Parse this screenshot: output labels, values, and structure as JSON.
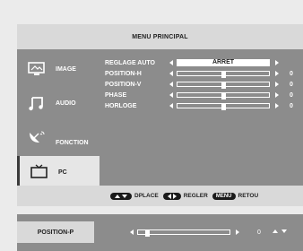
{
  "menu": {
    "title": "MENU PRINCIPAL",
    "sidebar": [
      {
        "label": "IMAGE",
        "icon": "monitor-icon",
        "active": false
      },
      {
        "label": "AUDIO",
        "icon": "music-note-icon",
        "active": false
      },
      {
        "label": "FONCTION",
        "icon": "satellite-dish-icon",
        "active": false
      },
      {
        "label": "PC",
        "icon": "tv-icon",
        "active": true
      }
    ],
    "settings": [
      {
        "label": "REGLAGE AUTO",
        "type": "select",
        "value": "ARRET"
      },
      {
        "label": "POSITION-H",
        "type": "slider",
        "value": "0",
        "level": 0.5
      },
      {
        "label": "POSITION-V",
        "type": "slider",
        "value": "0",
        "level": 0.5
      },
      {
        "label": "PHASE",
        "type": "slider",
        "value": "0",
        "level": 0.5
      },
      {
        "label": "HORLOGE",
        "type": "slider",
        "value": "0",
        "level": 0.5
      }
    ],
    "hints": {
      "move_label": "DPLACE",
      "adjust_label": "REGLER",
      "menu_key": "MENU",
      "back_label": "RETOU"
    }
  },
  "quick_bar": {
    "label": "POSITION-P",
    "value": "0",
    "level": 0.08
  },
  "colors": {
    "background": "#ebebeb",
    "panel": "#8c8c8c",
    "header": "#d9d9d9",
    "text_light": "#ffffff",
    "text_dark": "#222222"
  }
}
